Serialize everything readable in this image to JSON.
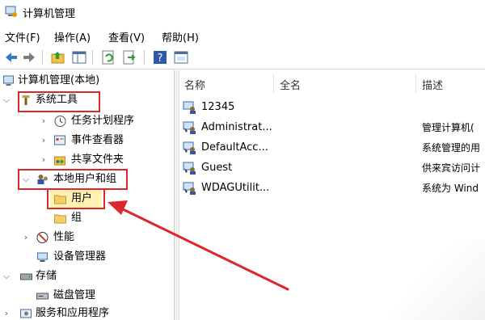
{
  "window": {
    "title": "计算机管理"
  },
  "menu": [
    "文件(F)",
    "操作(A)",
    "查看(V)",
    "帮助(H)"
  ],
  "toolbar": {
    "buttons": [
      "back-icon",
      "forward-icon",
      "up-folder-icon",
      "show-hide-tree-icon",
      "refresh-icon",
      "export-list-icon",
      "help-icon",
      "properties-icon"
    ]
  },
  "tree": {
    "root": "计算机管理(本地)",
    "system_tools": "系统工具",
    "task_scheduler": "任务计划程序",
    "event_viewer": "事件查看器",
    "shared_folders": "共享文件夹",
    "local_users_groups": "本地用户和组",
    "users": "用户",
    "groups": "组",
    "performance": "性能",
    "device_manager": "设备管理器",
    "storage": "存储",
    "disk_management": "磁盘管理",
    "services_apps": "服务和应用程序"
  },
  "columns": {
    "name": "名称",
    "full_name": "全名",
    "description": "描述"
  },
  "users": [
    {
      "name": "12345",
      "description": "",
      "disabled": false
    },
    {
      "name": "Administrat...",
      "description": "管理计算机(",
      "disabled": true
    },
    {
      "name": "DefaultAcc...",
      "description": "系统管理的用",
      "disabled": true
    },
    {
      "name": "Guest",
      "description": "供来宾访问计",
      "disabled": true
    },
    {
      "name": "WDAGUtilit...",
      "description": "系统为 Wind",
      "disabled": true
    }
  ],
  "colors": {
    "highlight_box": "#e0262d",
    "selected_bg": "#fff2b3"
  }
}
